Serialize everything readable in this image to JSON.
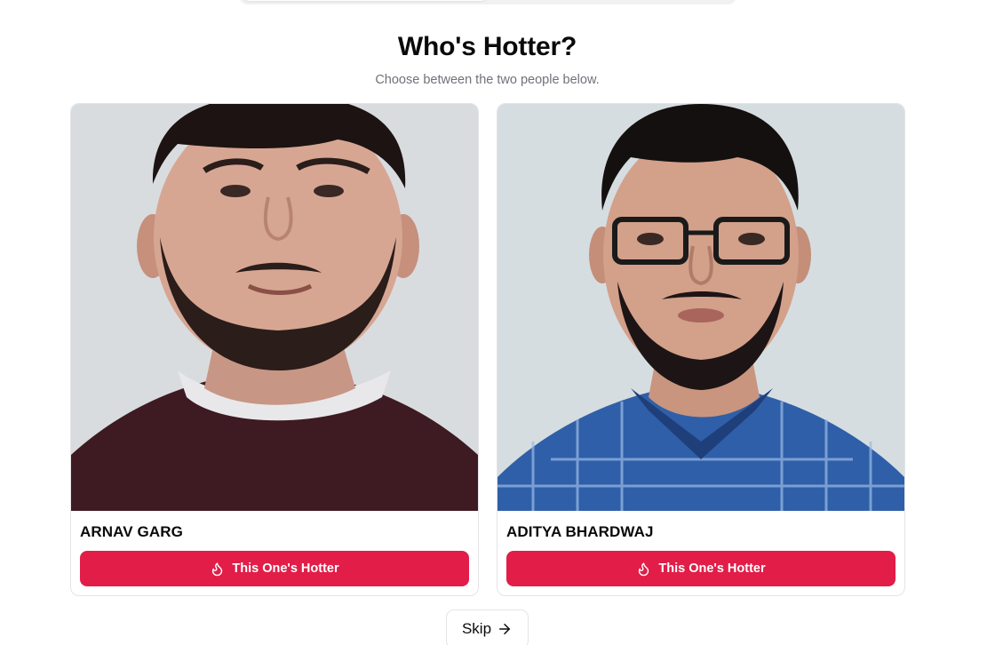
{
  "page": {
    "title": "Who's Hotter?",
    "subtitle": "Choose between the two people below."
  },
  "colors": {
    "accent": "#e11d48",
    "muted_text": "#71717a",
    "border": "#e4e4e7"
  },
  "candidates": [
    {
      "name": "ARNAV GARG",
      "vote_label": "This One's Hotter",
      "icon": "flame-icon"
    },
    {
      "name": "ADITYA BHARDWAJ",
      "vote_label": "This One's Hotter",
      "icon": "flame-icon"
    }
  ],
  "skip": {
    "label": "Skip",
    "icon": "arrow-right-icon"
  }
}
